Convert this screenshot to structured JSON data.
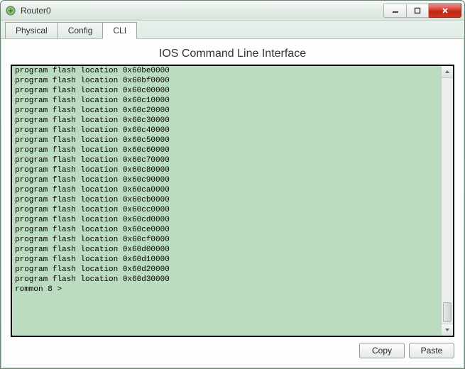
{
  "window": {
    "title": "Router0"
  },
  "tabs": {
    "physical": "Physical",
    "config": "Config",
    "cli": "CLI"
  },
  "panel": {
    "title": "IOS Command Line Interface"
  },
  "terminal": {
    "lines": [
      "program flash location 0x60be0000",
      "program flash location 0x60bf0000",
      "program flash location 0x60c00000",
      "program flash location 0x60c10000",
      "program flash location 0x60c20000",
      "program flash location 0x60c30000",
      "program flash location 0x60c40000",
      "program flash location 0x60c50000",
      "program flash location 0x60c60000",
      "program flash location 0x60c70000",
      "program flash location 0x60c80000",
      "program flash location 0x60c90000",
      "program flash location 0x60ca0000",
      "program flash location 0x60cb0000",
      "program flash location 0x60cc0000",
      "program flash location 0x60cd0000",
      "program flash location 0x60ce0000",
      "program flash location 0x60cf0000",
      "program flash location 0x60d00000",
      "program flash location 0x60d10000",
      "program flash location 0x60d20000",
      "program flash location 0x60d30000",
      "",
      "rommon 8 >"
    ]
  },
  "buttons": {
    "copy": "Copy",
    "paste": "Paste"
  }
}
